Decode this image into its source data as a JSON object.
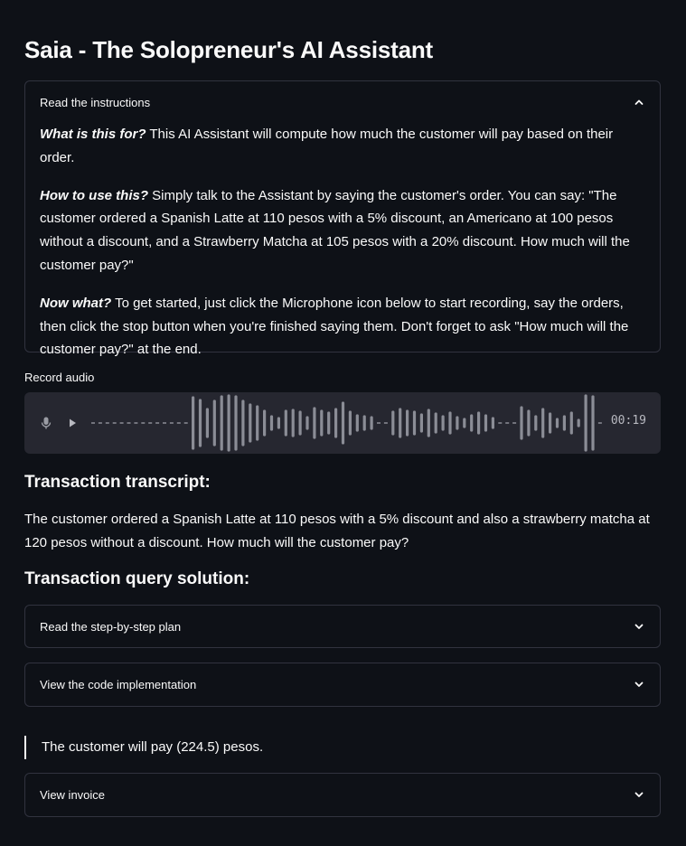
{
  "app": {
    "title": "Saia - The Solopreneur's AI Assistant"
  },
  "instructions": {
    "header": "Read the instructions",
    "expanded": true,
    "paragraphs": [
      {
        "lead": "What is this for?",
        "text": " This AI Assistant will compute how much the customer will pay based on their order."
      },
      {
        "lead": "How to use this?",
        "text": " Simply talk to the Assistant by saying the customer's order. You can say: \"The customer ordered a Spanish Latte at 110 pesos with a 5% discount, an Americano at 100 pesos without a discount, and a Strawberry Matcha at 105 pesos with a 20% discount. How much will the customer pay?\""
      },
      {
        "lead": "Now what?",
        "text": " To get started, just click the Microphone icon below to start recording, say the orders, then click the stop button when you're finished saying them. Don't forget to ask \"How much will the customer pay?\" at the end."
      }
    ]
  },
  "recorder": {
    "label": "Record audio",
    "timer": "00:19",
    "icons": [
      "microphone-icon",
      "play-icon"
    ]
  },
  "transcript": {
    "heading": "Transaction transcript:",
    "text": "The customer ordered a Spanish Latte at 110 pesos with a 5% discount and also a strawberry matcha at 120 pesos without a discount. How much will the customer pay?"
  },
  "solution": {
    "heading": "Transaction query solution:",
    "plan_header": "Read the step-by-step plan",
    "code_header": "View the code implementation",
    "answer": "The customer will pay (224.5) pesos.",
    "invoice_header": "View invoice"
  },
  "colors": {
    "background": "#0e1117",
    "border": "#31333f",
    "audio_bg": "#262730",
    "wave": "#8b8d96"
  }
}
